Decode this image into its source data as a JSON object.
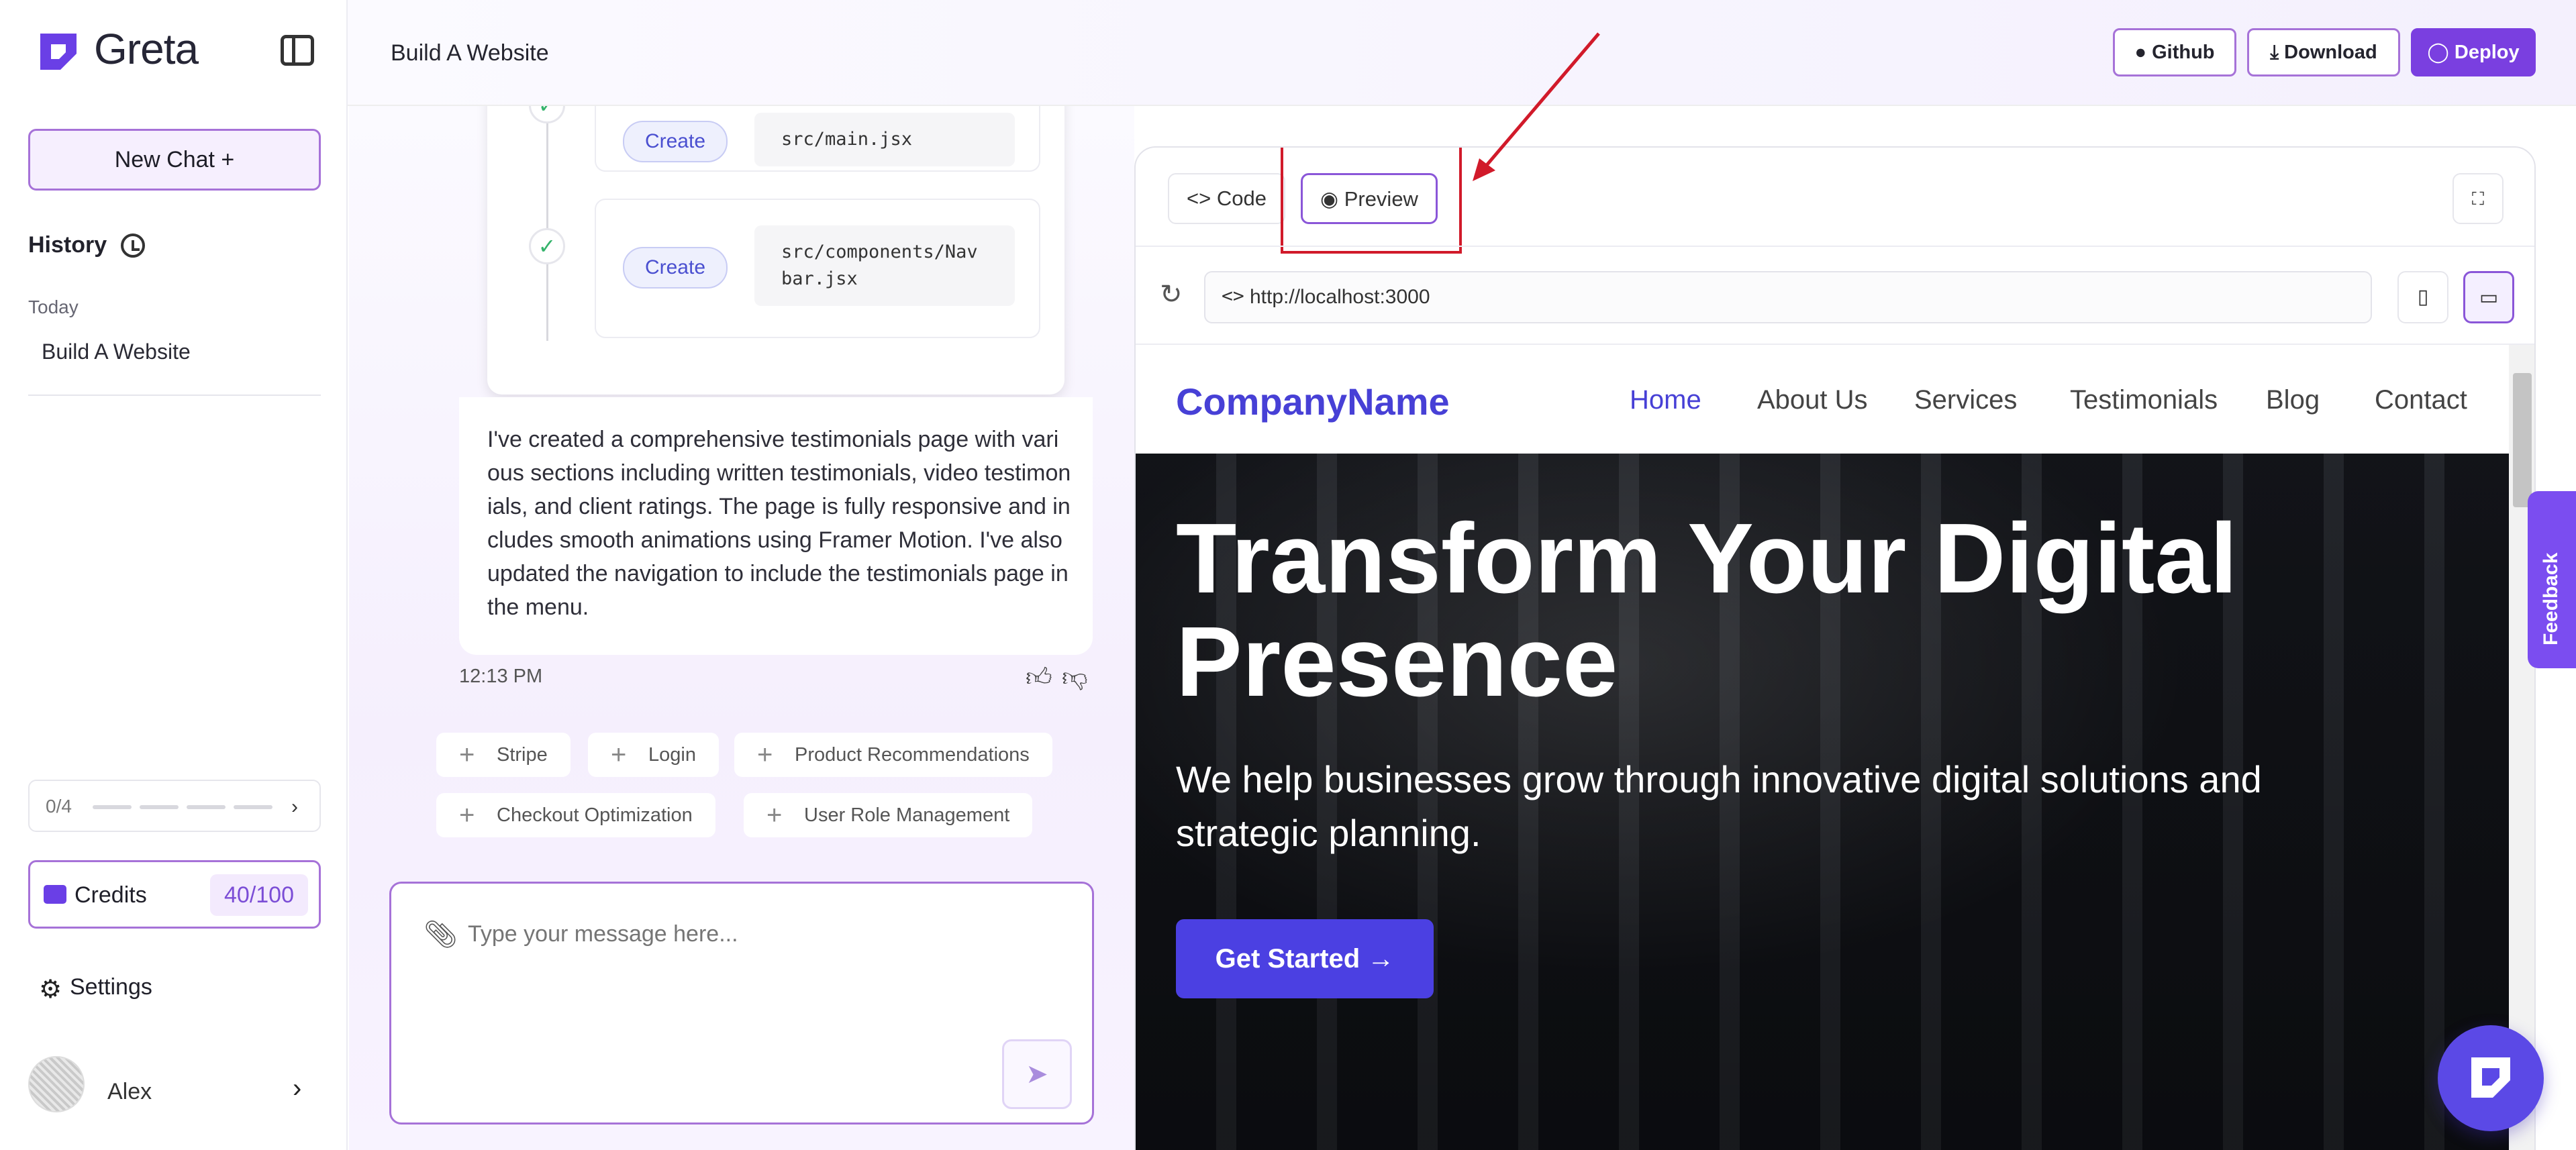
{
  "app": {
    "name": "Greta"
  },
  "sidebar": {
    "new_chat_label": "New Chat +",
    "history_label": "History",
    "today_label": "Today",
    "history_items": [
      "Build A Website"
    ],
    "progress_label": "0/4",
    "credits_label": "Credits",
    "credits_value": "40/100",
    "settings_label": "Settings",
    "user_name": "Alex"
  },
  "header": {
    "project_title": "Build A Website",
    "github_label": "Github",
    "download_label": "Download",
    "deploy_label": "Deploy"
  },
  "chat": {
    "steps": [
      {
        "action": "Create",
        "path": "src/main.jsx"
      },
      {
        "action": "Create",
        "path": "src/components/Navbar.jsx"
      }
    ],
    "message": "I've created a comprehensive testimonials page with various sections including written testimonials, video testimonials, and client ratings. The page is fully responsive and includes smooth animations using Framer Motion. I've also updated the navigation to include the testimonials page in the menu.",
    "time": "12:13 PM",
    "suggestions": [
      "Stripe",
      "Login",
      "Product Recommendations",
      "Checkout Optimization",
      "User Role Management"
    ],
    "input_placeholder": "Type your message here..."
  },
  "preview": {
    "tabs": [
      "Code",
      "Preview"
    ],
    "active_tab": "Preview",
    "url": "http://localhost:3000",
    "site": {
      "logo": "CompanyName",
      "nav": [
        "Home",
        "About Us",
        "Services",
        "Testimonials",
        "Blog",
        "Contact"
      ],
      "active_nav": "Home",
      "hero_title": "Transform Your Digital Presence",
      "hero_subtitle": "We help businesses grow through innovative digital solutions and strategic planning.",
      "cta_label": "Get Started"
    }
  },
  "feedback_label": "Feedback",
  "colors": {
    "accent": "#7a3fe0",
    "brand_blue": "#4740d6",
    "annotation_red": "#d11a2a"
  }
}
